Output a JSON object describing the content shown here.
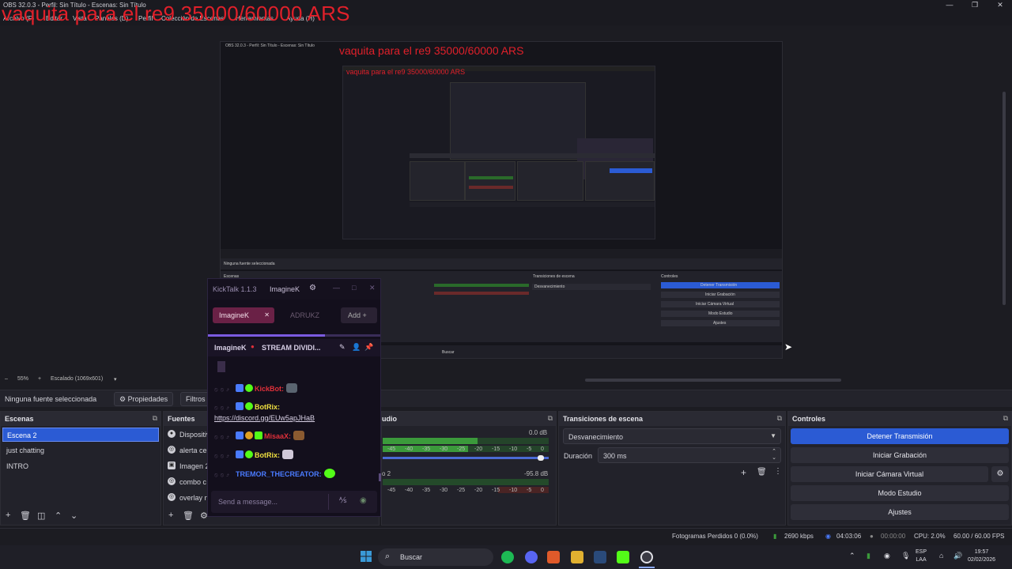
{
  "window": {
    "title": "OBS 32.0.3 - Perfil: Sin Título - Escenas: Sin Título",
    "min": "—",
    "max": "❐",
    "close": "✕"
  },
  "overlay_text": "vaquita para el re9 35000/60000 ARS",
  "menu": [
    "Archivo (F)",
    "Editar",
    "Vista",
    "Paneles (D)",
    "Perfil",
    "Colección de Escenas",
    "Herramientas",
    "Ayuda (H)"
  ],
  "preview": {
    "zoom": "55%",
    "scale": "Escalado (1069x601)"
  },
  "source_bar": {
    "no_source": "Ninguna fuente seleccionada",
    "properties": "Propiedades",
    "filters": "Filtros"
  },
  "scenes": {
    "title": "Escenas",
    "items": [
      "Escena 2",
      "just chatting",
      "INTRO"
    ]
  },
  "sources": {
    "title": "Fuentes",
    "items": [
      "Dispositivo",
      "alerta ce",
      "Imagen 2",
      "combo c",
      "overlay n"
    ]
  },
  "audio": {
    "title": "Mezclador de audio",
    "ch1_db": "0.0 dB",
    "ch2_db": "-95.8 dB",
    "ch2_label": "o 2",
    "scale_labels": [
      "-45",
      "-40",
      "-35",
      "-30",
      "-25",
      "-20",
      "-15",
      "-10",
      "-5",
      "0"
    ]
  },
  "transitions": {
    "title": "Transiciones de escena",
    "selected": "Desvanecimiento",
    "duration_label": "Duración",
    "duration_value": "300 ms"
  },
  "controls": {
    "title": "Controles",
    "buttons": [
      "Detener Transmisión",
      "Iniciar Grabación",
      "Iniciar Cámara Virtual",
      "Modo Estudio",
      "Ajustes"
    ]
  },
  "chat": {
    "app_title": "KickTalk 1.1.3",
    "user": "ImagineK",
    "tab_active": "ImagineK",
    "tab_inactive": "ADRUKZ",
    "add_label": "Add",
    "channel": "ImagineK",
    "stream_title": "STREAM DIVIDI...",
    "messages": [
      {
        "user": "KickBot:",
        "color": "#e0303a",
        "text": ""
      },
      {
        "user": "BotRix:",
        "color": "#f0e040",
        "text": "https://discord.gg/EUw5apJHaB"
      },
      {
        "user": "MisaaX:",
        "color": "#e0303a",
        "text": ""
      },
      {
        "user": "BotRix:",
        "color": "#f0e040",
        "text": ""
      },
      {
        "user": "TREMOR_THECREATOR:",
        "color": "#4a7bff",
        "text": ""
      }
    ],
    "placeholder": "Send a message..."
  },
  "status": {
    "dropped": "Fotogramas Perdidos 0 (0.0%)",
    "bitrate": "2690 kbps",
    "stream_time": "04:03:06",
    "rec_time": "00:00:00",
    "cpu": "CPU: 2.0%",
    "fps": "60.00 / 60.00 FPS"
  },
  "taskbar": {
    "search": "Buscar",
    "lang": "ESP",
    "lang2": "LAA",
    "time": "19:57",
    "date": "02/02/2026"
  },
  "colors": {
    "accent": "#2b5bd4",
    "red_overlay": "#e0202a",
    "kick_green": "#53fc18"
  }
}
